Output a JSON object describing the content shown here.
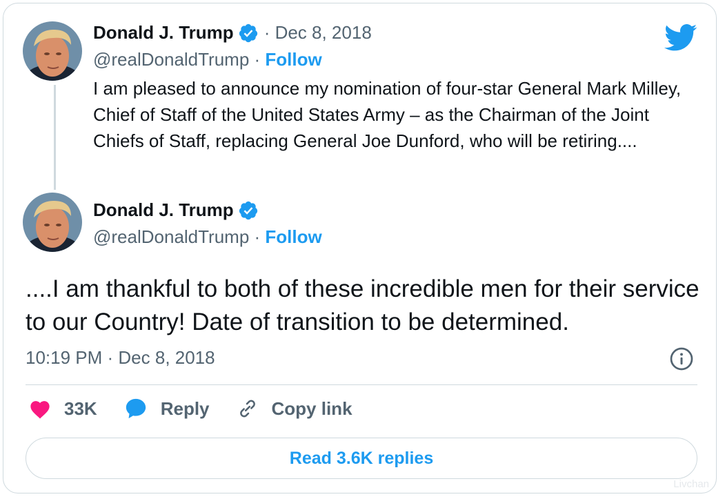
{
  "tweet1": {
    "author_name": "Donald J. Trump",
    "handle": "@realDonaldTrump",
    "separator": " · ",
    "follow_label": "Follow",
    "date": "· Dec 8, 2018",
    "text": "I am pleased to announce my nomination of four-star General Mark Milley, Chief of Staff of the United States Army – as the Chairman of the Joint Chiefs of Staff, replacing General Joe Dunford, who will be retiring...."
  },
  "tweet2": {
    "author_name": "Donald J. Trump",
    "handle": "@realDonaldTrump",
    "separator": " · ",
    "follow_label": "Follow",
    "text": "....I am thankful to both of these incredible men for their service to our Country! Date of transition to be determined.",
    "timestamp": "10:19 PM · Dec 8, 2018"
  },
  "actions": {
    "likes_count": "33K",
    "reply_label": "Reply",
    "copy_link_label": "Copy link"
  },
  "read_replies_label": "Read 3.6K replies",
  "watermark": "Livchan",
  "colors": {
    "accent": "#1d9bf0",
    "like": "#f91880",
    "secondary_text": "#536471",
    "border": "#cfd9de"
  },
  "icons": [
    "twitter-logo-icon",
    "verified-badge-icon",
    "info-icon",
    "heart-icon",
    "reply-bubble-icon",
    "link-icon"
  ]
}
